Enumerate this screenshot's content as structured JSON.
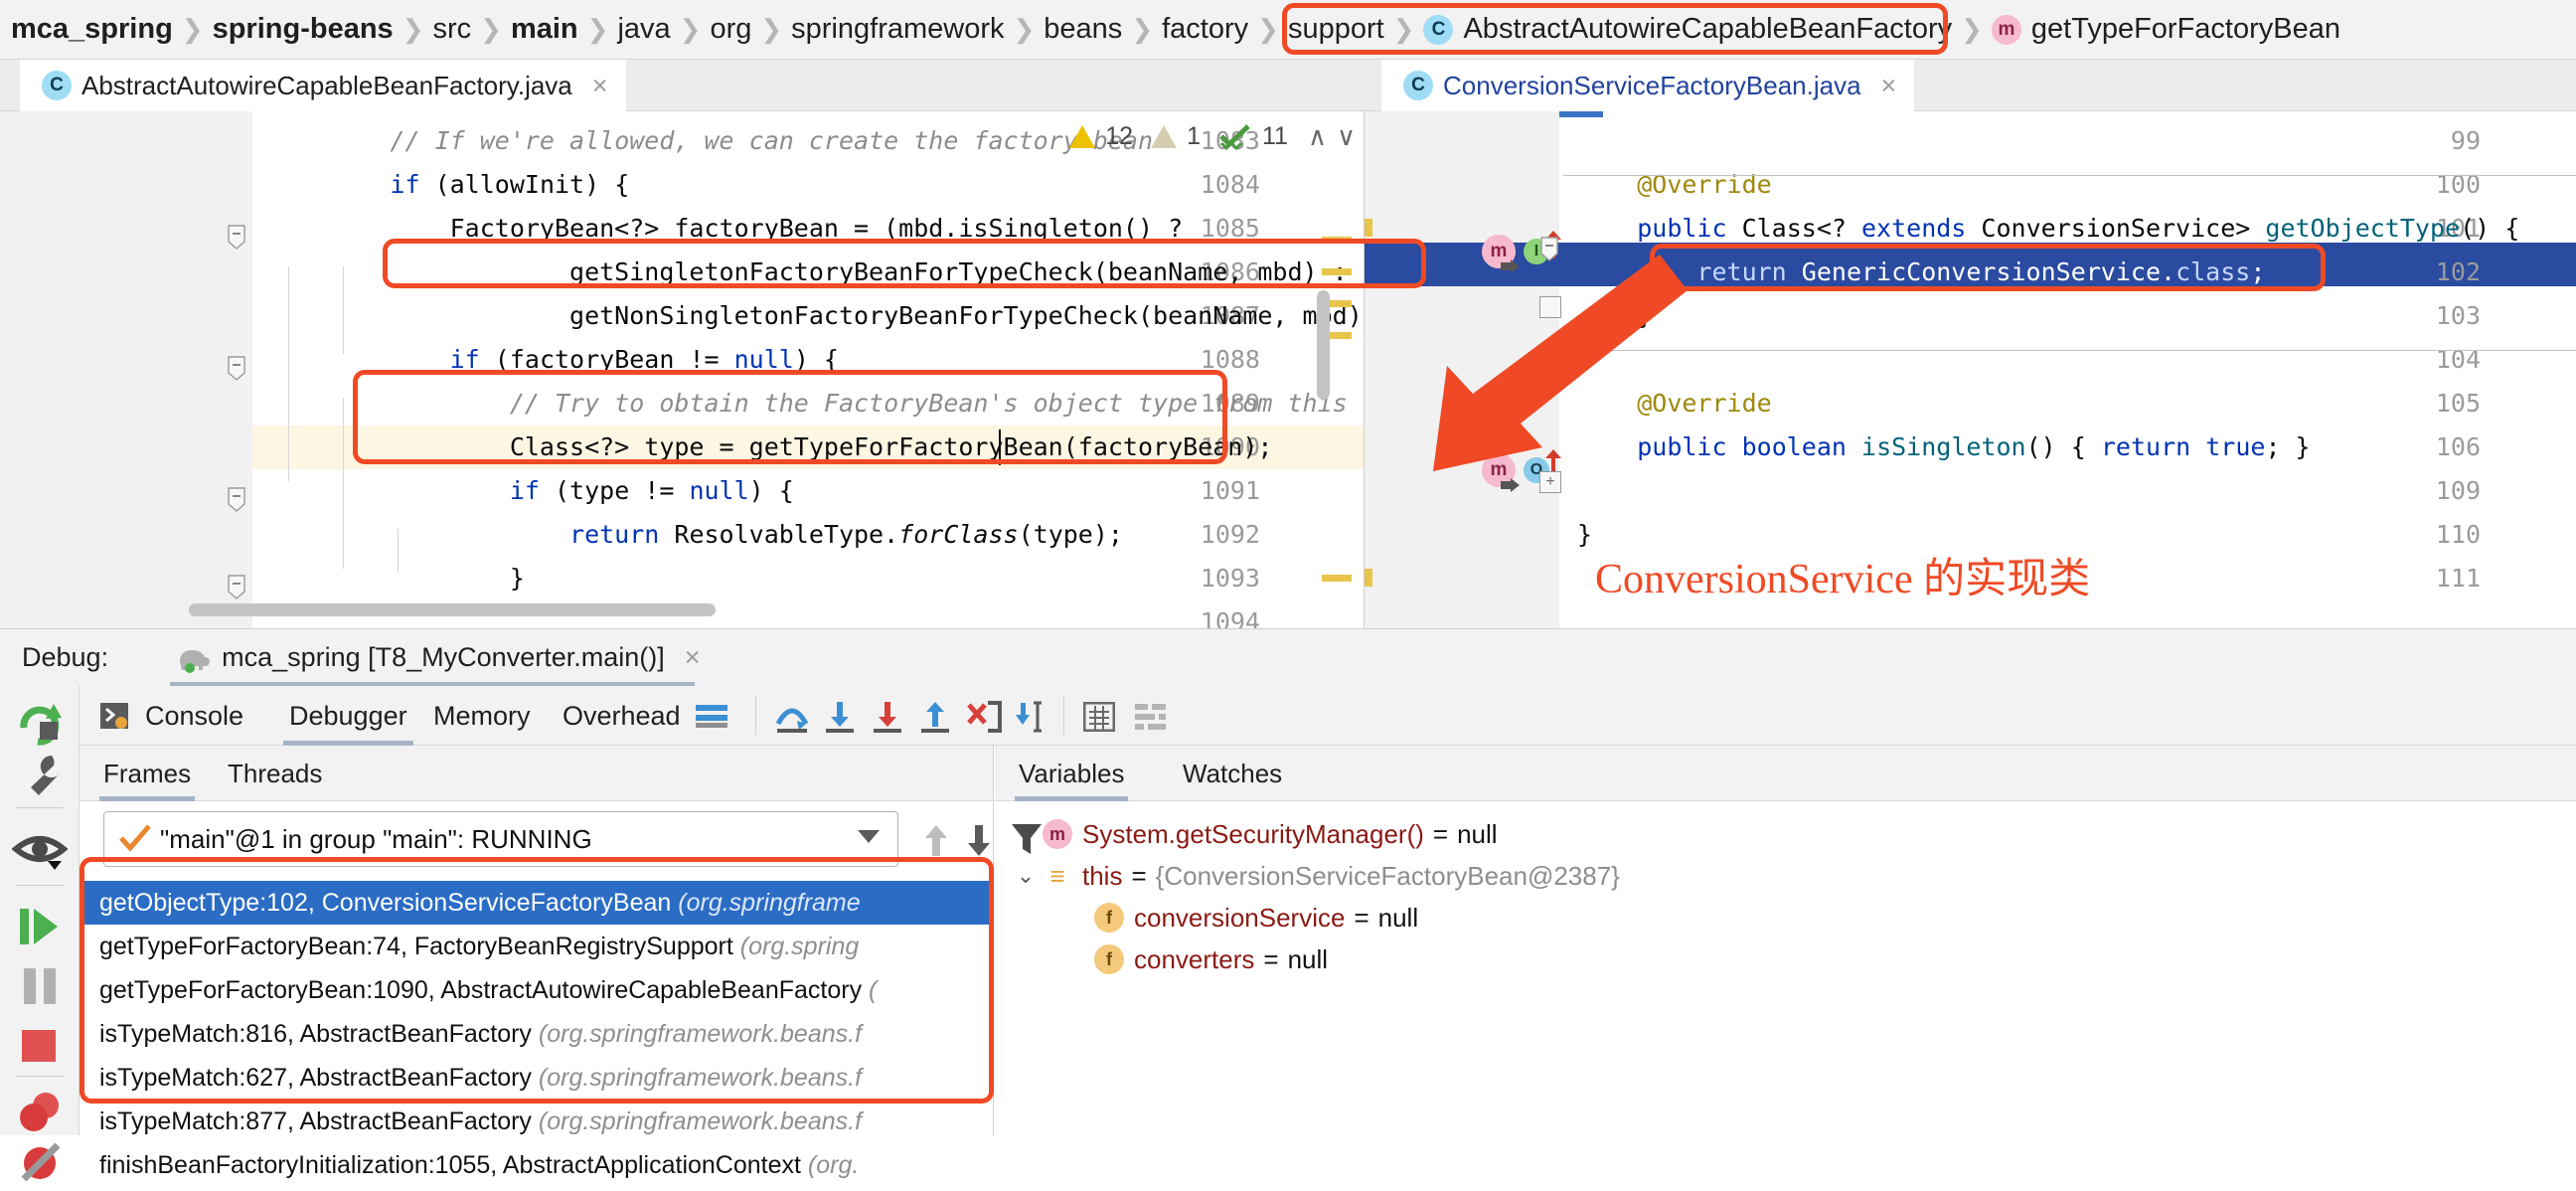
{
  "breadcrumb": {
    "items": [
      {
        "label": "mca_spring",
        "bold": true,
        "icon": null
      },
      {
        "label": "spring-beans",
        "bold": true,
        "icon": null
      },
      {
        "label": "src",
        "bold": false,
        "icon": null
      },
      {
        "label": "main",
        "bold": true,
        "icon": null
      },
      {
        "label": "java",
        "bold": false,
        "icon": null
      },
      {
        "label": "org",
        "bold": false,
        "icon": null
      },
      {
        "label": "springframework",
        "bold": false,
        "icon": null
      },
      {
        "label": "beans",
        "bold": false,
        "icon": null
      },
      {
        "label": "factory",
        "bold": false,
        "icon": null
      },
      {
        "label": "support",
        "bold": false,
        "icon": null
      },
      {
        "label": "AbstractAutowireCapableBeanFactory",
        "bold": false,
        "icon": "class-icon"
      },
      {
        "label": "getTypeForFactoryBean",
        "bold": false,
        "icon": "method-icon"
      }
    ],
    "separator": "❯"
  },
  "editor_left": {
    "tab": {
      "label": "AbstractAutowireCapableBeanFactory.java",
      "icon": "class-icon",
      "close": "×"
    },
    "first_line_number": 1083,
    "lines": [
      {
        "num": "1083",
        "tokens": [
          {
            "t": "        ",
            "c": ""
          },
          {
            "t": "// If we're allowed, we can create the factory bean",
            "c": "com"
          }
        ]
      },
      {
        "num": "1084",
        "tokens": [
          {
            "t": "        ",
            "c": ""
          },
          {
            "t": "if",
            "c": "kw"
          },
          {
            "t": " (allowInit) {",
            "c": ""
          }
        ]
      },
      {
        "num": "1085",
        "tokens": [
          {
            "t": "            FactoryBean<?> factoryBean = (mbd.isSingleton() ?",
            "c": ""
          }
        ]
      },
      {
        "num": "1086",
        "tokens": [
          {
            "t": "                    getSingletonFactoryBeanForTypeCheck(beanName, mbd) :",
            "c": ""
          }
        ]
      },
      {
        "num": "1087",
        "tokens": [
          {
            "t": "                    getNonSingletonFactoryBeanForTypeCheck(beanName, mbd));",
            "c": ""
          }
        ]
      },
      {
        "num": "1088",
        "tokens": [
          {
            "t": "            ",
            "c": ""
          },
          {
            "t": "if",
            "c": "kw"
          },
          {
            "t": " (factoryBean != ",
            "c": ""
          },
          {
            "t": "null",
            "c": "kw"
          },
          {
            "t": ") {",
            "c": ""
          }
        ]
      },
      {
        "num": "1089",
        "tokens": [
          {
            "t": "                ",
            "c": ""
          },
          {
            "t": "// Try to obtain the FactoryBean's object type from this early",
            "c": "com"
          }
        ]
      },
      {
        "num": "1090",
        "tokens": [
          {
            "t": "                Class<?> type = getTypeForFactoryBean(factoryBean);",
            "c": ""
          }
        ]
      },
      {
        "num": "1091",
        "tokens": [
          {
            "t": "                ",
            "c": ""
          },
          {
            "t": "if",
            "c": "kw"
          },
          {
            "t": " (type != ",
            "c": ""
          },
          {
            "t": "null",
            "c": "kw"
          },
          {
            "t": ") {",
            "c": ""
          }
        ]
      },
      {
        "num": "1092",
        "tokens": [
          {
            "t": "                    ",
            "c": ""
          },
          {
            "t": "return",
            "c": "kw"
          },
          {
            "t": " ResolvableType.",
            "c": ""
          },
          {
            "t": "forClass",
            "c": "ital"
          },
          {
            "t": "(type);",
            "c": ""
          }
        ]
      },
      {
        "num": "1093",
        "tokens": [
          {
            "t": "                }",
            "c": ""
          }
        ]
      },
      {
        "num": "1094",
        "tokens": [
          {
            "t": "",
            "c": ""
          }
        ]
      }
    ],
    "caret_line": "1090"
  },
  "editor_right": {
    "tab": {
      "label": "ConversionServiceFactoryBean.java",
      "icon": "class-icon",
      "close": "×"
    },
    "lines": [
      {
        "num": "99",
        "tokens": [
          {
            "t": "",
            "c": ""
          }
        ]
      },
      {
        "num": "100",
        "tokens": [
          {
            "t": "    ",
            "c": ""
          },
          {
            "t": "@Override",
            "c": "ann"
          }
        ]
      },
      {
        "num": "101",
        "tokens": [
          {
            "t": "    ",
            "c": ""
          },
          {
            "t": "public",
            "c": "kw"
          },
          {
            "t": " Class<? ",
            "c": ""
          },
          {
            "t": "extends",
            "c": "kw"
          },
          {
            "t": " ConversionService> ",
            "c": ""
          },
          {
            "t": "getObjectType",
            "c": "meth"
          },
          {
            "t": "() {",
            "c": ""
          }
        ]
      },
      {
        "num": "102",
        "tokens": [
          {
            "t": "        ",
            "c": ""
          },
          {
            "t": "return",
            "c": "kw"
          },
          {
            "t": " GenericConversionService.",
            "c": ""
          },
          {
            "t": "class",
            "c": "kw"
          },
          {
            "t": ";",
            "c": ""
          }
        ]
      },
      {
        "num": "103",
        "tokens": [
          {
            "t": "    }",
            "c": ""
          }
        ]
      },
      {
        "num": "104",
        "tokens": [
          {
            "t": "",
            "c": ""
          }
        ]
      },
      {
        "num": "105",
        "tokens": [
          {
            "t": "    ",
            "c": ""
          },
          {
            "t": "@Override",
            "c": "ann"
          }
        ]
      },
      {
        "num": "106",
        "tokens": [
          {
            "t": "    ",
            "c": ""
          },
          {
            "t": "public",
            "c": "kw"
          },
          {
            "t": " ",
            "c": ""
          },
          {
            "t": "boolean",
            "c": "kw"
          },
          {
            "t": " ",
            "c": ""
          },
          {
            "t": "isSingleton",
            "c": "meth"
          },
          {
            "t": "() { ",
            "c": ""
          },
          {
            "t": "return",
            "c": "kw"
          },
          {
            "t": " ",
            "c": ""
          },
          {
            "t": "true",
            "c": "kw"
          },
          {
            "t": "; }",
            "c": ""
          }
        ]
      },
      {
        "num": "109",
        "tokens": [
          {
            "t": "",
            "c": ""
          }
        ]
      },
      {
        "num": "110",
        "tokens": [
          {
            "t": "}",
            "c": ""
          }
        ]
      },
      {
        "num": "111",
        "tokens": [
          {
            "t": "",
            "c": ""
          }
        ]
      }
    ],
    "highlighted_line": "102"
  },
  "inspections": {
    "warning_count": "12",
    "weak_warning_count": "1",
    "ok_count": "11",
    "prev_icon": "∧",
    "next_icon": "∨"
  },
  "annotation": {
    "chinese_note": "ConversionService 的实现类",
    "accent_color": "#ef4a25"
  },
  "debug": {
    "label": "Debug:",
    "session": "mca_spring [T8_MyConverter.main()]",
    "session_close": "×",
    "session_icon": "spring-boot-icon",
    "tabs": [
      {
        "label": "Console",
        "active": false,
        "icon": "console-icon"
      },
      {
        "label": "Debugger",
        "active": true,
        "icon": null
      },
      {
        "label": "Memory",
        "active": false,
        "icon": null
      },
      {
        "label": "Overhead",
        "active": false,
        "icon": null
      }
    ],
    "toolbar_icons": [
      "layout-settings-icon",
      "step-over-icon",
      "step-into-icon",
      "force-step-into-icon",
      "step-out-icon",
      "drop-frame-icon",
      "run-to-cursor-icon",
      "evaluate-expression-icon",
      "settings-icon"
    ],
    "rail_icons": [
      "rerun-icon",
      "edit-configuration-icon",
      "watch-icon",
      "resume-program-icon",
      "pause-program-icon",
      "stop-icon",
      "view-breakpoints-icon",
      "mute-breakpoints-icon"
    ]
  },
  "frames": {
    "tabs": [
      {
        "label": "Frames",
        "active": true
      },
      {
        "label": "Threads",
        "active": false
      }
    ],
    "thread_selector": {
      "value": "\"main\"@1 in group \"main\": RUNNING",
      "status_icon": "check-icon"
    },
    "toolbar_icons": [
      "move-up-icon",
      "move-down-icon",
      "filter-icon"
    ],
    "items": [
      {
        "method": "getObjectType:102, ConversionServiceFactoryBean",
        "pkg": "(org.springframe",
        "selected": true
      },
      {
        "method": "getTypeForFactoryBean:74, FactoryBeanRegistrySupport",
        "pkg": "(org.spring",
        "selected": false
      },
      {
        "method": "getTypeForFactoryBean:1090, AbstractAutowireCapableBeanFactory",
        "pkg": "(",
        "selected": false
      },
      {
        "method": "isTypeMatch:816, AbstractBeanFactory",
        "pkg": "(org.springframework.beans.f",
        "selected": false
      },
      {
        "method": "isTypeMatch:627, AbstractBeanFactory",
        "pkg": "(org.springframework.beans.f",
        "selected": false
      },
      {
        "method": "isTypeMatch:877, AbstractBeanFactory",
        "pkg": "(org.springframework.beans.f",
        "selected": false
      },
      {
        "method": "finishBeanFactoryInitialization:1055, AbstractApplicationContext",
        "pkg": "(org.",
        "selected": false
      }
    ]
  },
  "variables": {
    "tabs": [
      {
        "label": "Variables",
        "active": true
      },
      {
        "label": "Watches",
        "active": false
      }
    ],
    "rows": [
      {
        "indent": 0,
        "twisty": "",
        "badge": "mm",
        "badge_text": "m",
        "name": "System.getSecurityManager()",
        "eq": "=",
        "value": "null",
        "grey": false
      },
      {
        "indent": 0,
        "twisty": "⌄",
        "badge": "obj",
        "badge_text": "≡",
        "name": "this",
        "eq": "=",
        "value": "{ConversionServiceFactoryBean@2387}",
        "grey": true
      },
      {
        "indent": 1,
        "twisty": "",
        "badge": "f",
        "badge_text": "f",
        "name": "conversionService",
        "eq": "=",
        "value": "null",
        "grey": false
      },
      {
        "indent": 1,
        "twisty": "",
        "badge": "f",
        "badge_text": "f",
        "name": "converters",
        "eq": "=",
        "value": "null",
        "grey": false
      }
    ]
  }
}
